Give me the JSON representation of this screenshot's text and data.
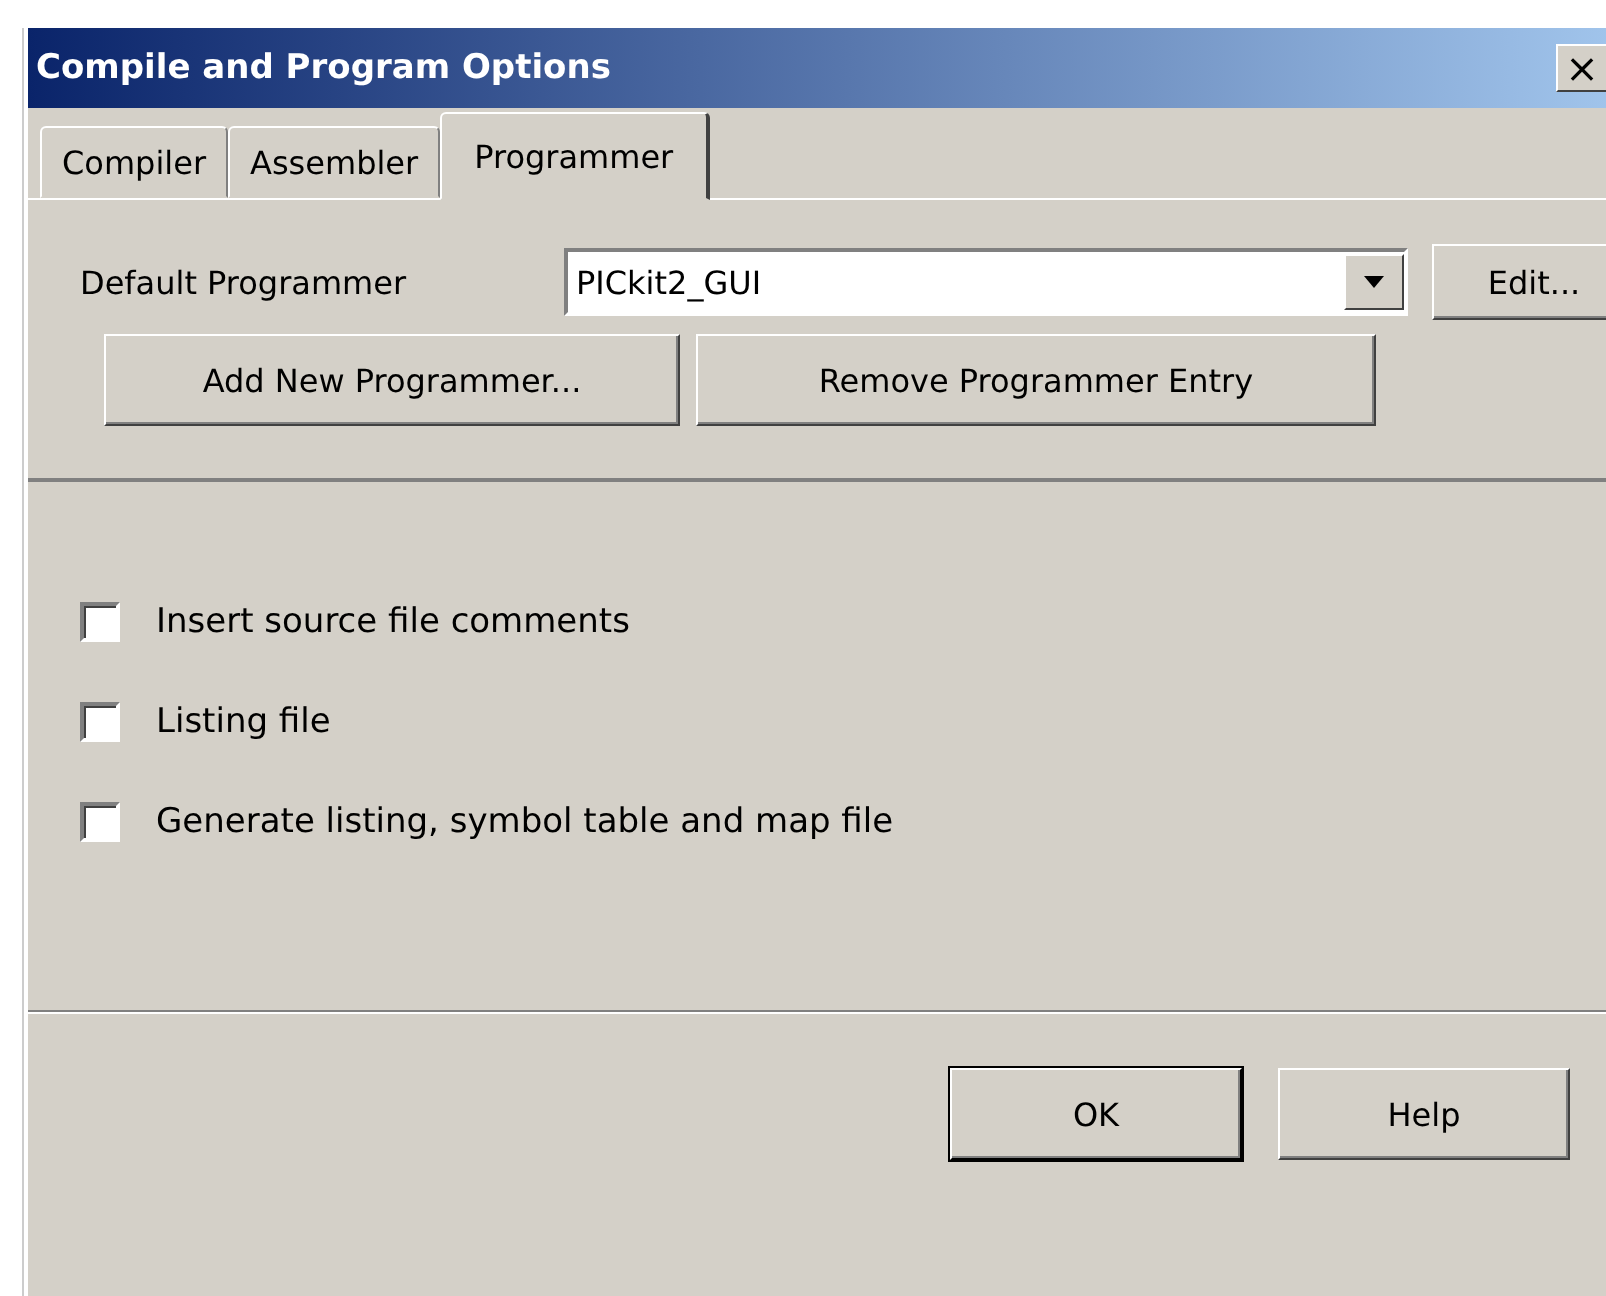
{
  "window": {
    "title": "Compile and Program Options",
    "close": "×"
  },
  "tabs": [
    {
      "label": "Compiler",
      "selected": false
    },
    {
      "label": "Assembler",
      "selected": false
    },
    {
      "label": "Programmer",
      "selected": true
    }
  ],
  "programmer": {
    "label": "Default Programmer",
    "value": "PICkit2_GUI",
    "edit": "Edit...",
    "add": "Add New Programmer...",
    "remove": "Remove Programmer Entry"
  },
  "options": [
    {
      "label": "Insert source file comments",
      "checked": false
    },
    {
      "label": "Listing file",
      "checked": false
    },
    {
      "label": "Generate listing, symbol table and map file",
      "checked": false
    }
  ],
  "buttons": [
    {
      "label": "OK",
      "default": true
    },
    {
      "label": "Help",
      "default": false
    }
  ]
}
